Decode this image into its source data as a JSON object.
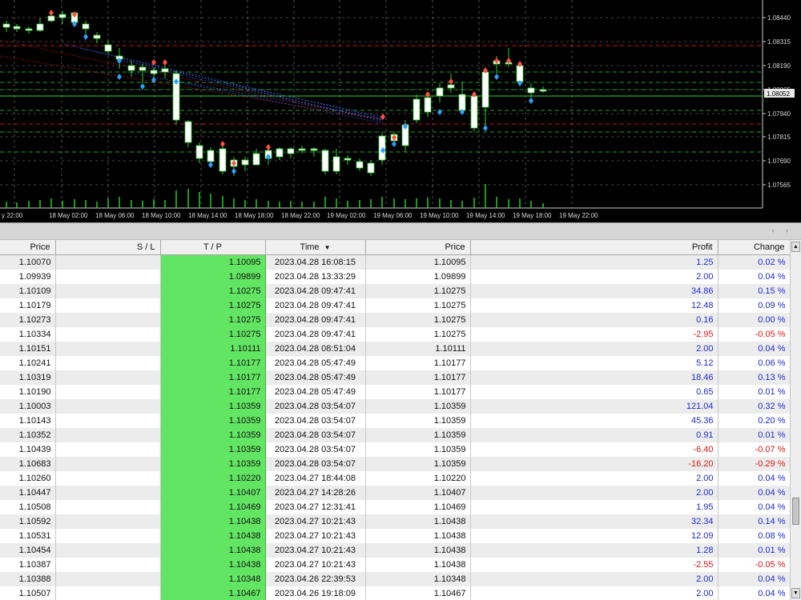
{
  "chart": {
    "price_labels": [
      "1.08440",
      "1.08315",
      "1.08190",
      "1.08065",
      "1.07940",
      "1.07815",
      "1.07690",
      "1.07565"
    ],
    "current_price": "1.08052",
    "time_labels": [
      "y 22:00",
      "18 May 02:00",
      "18 May 06:00",
      "18 May 10:00",
      "18 May 14:00",
      "18 May 18:00",
      "18 May 22:00",
      "19 May 02:00",
      "19 May 06:00",
      "19 May 10:00",
      "19 May 14:00",
      "19 May 18:00",
      "19 May 22:00"
    ],
    "colors": {
      "background": "#000000",
      "grid": "#8a8a8a",
      "candle_up": "#ffffff",
      "candle_wick": "#2bd12b",
      "volume": "#1fd11f",
      "level_red": "#c0181e",
      "level_green": "#1ea51e",
      "trade_lines": "#3a5bd6",
      "marker_red": "#ff5040",
      "marker_blue": "#2aa0ff"
    }
  },
  "table": {
    "headers": {
      "price": "Price",
      "sl": "S / L",
      "tp": "T / P",
      "time": "Time",
      "price2": "Price",
      "profit": "Profit",
      "change": "Change"
    },
    "sort_icon": "sort-descending-icon",
    "rows": [
      {
        "price": "1.10070",
        "sl": "",
        "tp": "1.10095",
        "time": "2023.04.28 16:08:15",
        "price2": "1.10095",
        "profit": "1.25",
        "change": "0.02 %",
        "neg": false
      },
      {
        "price": "1.09939",
        "sl": "",
        "tp": "1.09899",
        "time": "2023.04.28 13:33:29",
        "price2": "1.09899",
        "profit": "2.00",
        "change": "0.04 %",
        "neg": false
      },
      {
        "price": "1.10109",
        "sl": "",
        "tp": "1.10275",
        "time": "2023.04.28 09:47:41",
        "price2": "1.10275",
        "profit": "34.86",
        "change": "0.15 %",
        "neg": false
      },
      {
        "price": "1.10179",
        "sl": "",
        "tp": "1.10275",
        "time": "2023.04.28 09:47:41",
        "price2": "1.10275",
        "profit": "12.48",
        "change": "0.09 %",
        "neg": false
      },
      {
        "price": "1.10273",
        "sl": "",
        "tp": "1.10275",
        "time": "2023.04.28 09:47:41",
        "price2": "1.10275",
        "profit": "0.16",
        "change": "0.00 %",
        "neg": false
      },
      {
        "price": "1.10334",
        "sl": "",
        "tp": "1.10275",
        "time": "2023.04.28 09:47:41",
        "price2": "1.10275",
        "profit": "-2.95",
        "change": "-0.05 %",
        "neg": true
      },
      {
        "price": "1.10151",
        "sl": "",
        "tp": "1.10111",
        "time": "2023.04.28 08:51:04",
        "price2": "1.10111",
        "profit": "2.00",
        "change": "0.04 %",
        "neg": false
      },
      {
        "price": "1.10241",
        "sl": "",
        "tp": "1.10177",
        "time": "2023.04.28 05:47:49",
        "price2": "1.10177",
        "profit": "5.12",
        "change": "0.06 %",
        "neg": false
      },
      {
        "price": "1.10319",
        "sl": "",
        "tp": "1.10177",
        "time": "2023.04.28 05:47:49",
        "price2": "1.10177",
        "profit": "18.46",
        "change": "0.13 %",
        "neg": false
      },
      {
        "price": "1.10190",
        "sl": "",
        "tp": "1.10177",
        "time": "2023.04.28 05:47:49",
        "price2": "1.10177",
        "profit": "0.65",
        "change": "0.01 %",
        "neg": false
      },
      {
        "price": "1.10003",
        "sl": "",
        "tp": "1.10359",
        "time": "2023.04.28 03:54:07",
        "price2": "1.10359",
        "profit": "121.04",
        "change": "0.32 %",
        "neg": false
      },
      {
        "price": "1.10143",
        "sl": "",
        "tp": "1.10359",
        "time": "2023.04.28 03:54:07",
        "price2": "1.10359",
        "profit": "45.36",
        "change": "0.20 %",
        "neg": false
      },
      {
        "price": "1.10352",
        "sl": "",
        "tp": "1.10359",
        "time": "2023.04.28 03:54:07",
        "price2": "1.10359",
        "profit": "0.91",
        "change": "0.01 %",
        "neg": false
      },
      {
        "price": "1.10439",
        "sl": "",
        "tp": "1.10359",
        "time": "2023.04.28 03:54:07",
        "price2": "1.10359",
        "profit": "-6.40",
        "change": "-0.07 %",
        "neg": true
      },
      {
        "price": "1.10683",
        "sl": "",
        "tp": "1.10359",
        "time": "2023.04.28 03:54:07",
        "price2": "1.10359",
        "profit": "-16.20",
        "change": "-0.29 %",
        "neg": true
      },
      {
        "price": "1.10260",
        "sl": "",
        "tp": "1.10220",
        "time": "2023.04.27 18:44:08",
        "price2": "1.10220",
        "profit": "2.00",
        "change": "0.04 %",
        "neg": false
      },
      {
        "price": "1.10447",
        "sl": "",
        "tp": "1.10407",
        "time": "2023.04.27 14:28:26",
        "price2": "1.10407",
        "profit": "2.00",
        "change": "0.04 %",
        "neg": false
      },
      {
        "price": "1.10508",
        "sl": "",
        "tp": "1.10469",
        "time": "2023.04.27 12:31:41",
        "price2": "1.10469",
        "profit": "1.95",
        "change": "0.04 %",
        "neg": false
      },
      {
        "price": "1.10592",
        "sl": "",
        "tp": "1.10438",
        "time": "2023.04.27 10:21:43",
        "price2": "1.10438",
        "profit": "32.34",
        "change": "0.14 %",
        "neg": false
      },
      {
        "price": "1.10531",
        "sl": "",
        "tp": "1.10438",
        "time": "2023.04.27 10:21:43",
        "price2": "1.10438",
        "profit": "12.09",
        "change": "0.08 %",
        "neg": false
      },
      {
        "price": "1.10454",
        "sl": "",
        "tp": "1.10438",
        "time": "2023.04.27 10:21:43",
        "price2": "1.10438",
        "profit": "1.28",
        "change": "0.01 %",
        "neg": false
      },
      {
        "price": "1.10387",
        "sl": "",
        "tp": "1.10438",
        "time": "2023.04.27 10:21:43",
        "price2": "1.10438",
        "profit": "-2.55",
        "change": "-0.05 %",
        "neg": true
      },
      {
        "price": "1.10388",
        "sl": "",
        "tp": "1.10348",
        "time": "2023.04.26 22:39:53",
        "price2": "1.10348",
        "profit": "2.00",
        "change": "0.04 %",
        "neg": false
      },
      {
        "price": "1.10507",
        "sl": "",
        "tp": "1.10467",
        "time": "2023.04.26 19:18:09",
        "price2": "1.10467",
        "profit": "2.00",
        "change": "0.04 %",
        "neg": false
      }
    ]
  },
  "scrollbar": {
    "up_icon": "scroll-up-icon",
    "down_icon": "scroll-down-icon"
  }
}
